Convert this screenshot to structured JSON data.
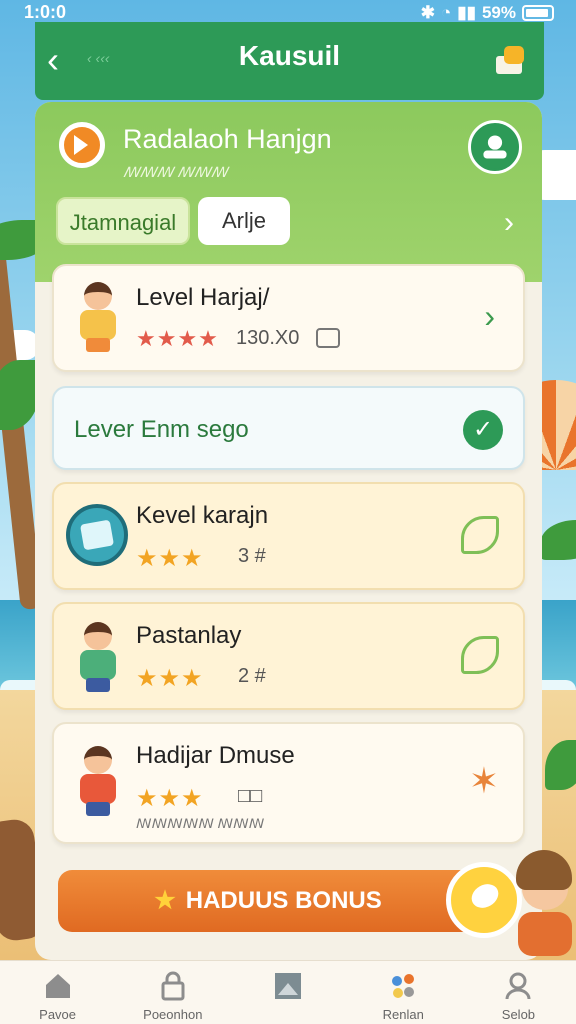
{
  "status_bar": {
    "time": "1:0:0",
    "battery": "59%"
  },
  "header": {
    "title": "Kausuil",
    "back_subtext": "‹ ‹‹‹"
  },
  "profile": {
    "name": "Radalaoh Hanjgn",
    "subtitle": "ꟿꟿꟿ ꟿꟿꟿ"
  },
  "tabs": [
    {
      "label": "Jtamnagial"
    },
    {
      "label": "Arlje"
    }
  ],
  "levels": [
    {
      "title": "Level Harjaj/",
      "score": "130.X0"
    },
    {
      "title": "Lever Enm sego"
    },
    {
      "title": "Kevel karajn",
      "score": "3 #"
    },
    {
      "title": "Pastanlay",
      "score": "2 #"
    },
    {
      "title": "Hadijar Dmuse",
      "score": "□□",
      "small": "ꟿꟿꟿꟿꟿ ꟿꟿꟿ"
    }
  ],
  "stars": {
    "row": "★★★",
    "row4": "★★★★"
  },
  "bonus": {
    "label": "HADUUS BONUS"
  },
  "nav": [
    {
      "label": "Pavoe",
      "icon": "home-icon"
    },
    {
      "label": "Poeonhon",
      "icon": "lock-icon"
    },
    {
      "label": "",
      "icon": "picture-icon"
    },
    {
      "label": "Renlan",
      "icon": "dots-icon"
    },
    {
      "label": "Selob",
      "icon": "person-icon"
    }
  ],
  "colors": {
    "brand": "#2d9a57",
    "accent": "#e9742c",
    "star": "#f2a423"
  }
}
